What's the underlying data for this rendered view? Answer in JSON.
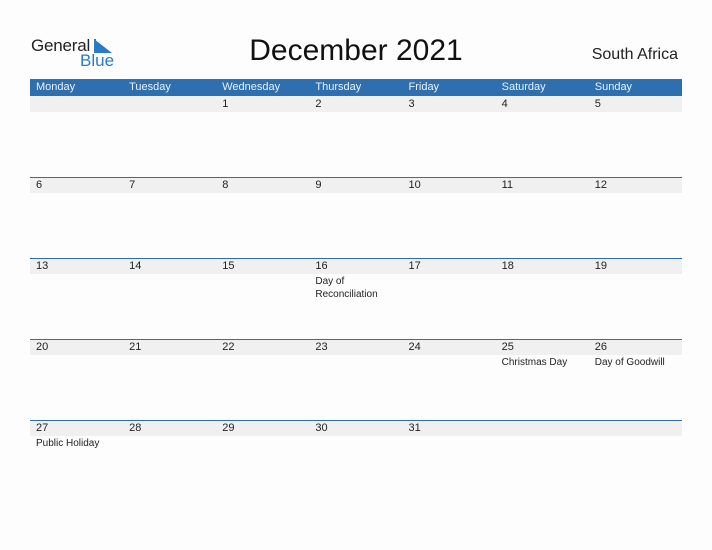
{
  "logo": {
    "line1": "General",
    "line2": "Blue"
  },
  "title": "December 2021",
  "country": "South Africa",
  "weekdays": [
    "Monday",
    "Tuesday",
    "Wednesday",
    "Thursday",
    "Friday",
    "Saturday",
    "Sunday"
  ],
  "weeks": [
    [
      {
        "d": ""
      },
      {
        "d": ""
      },
      {
        "d": "1"
      },
      {
        "d": "2"
      },
      {
        "d": "3"
      },
      {
        "d": "4"
      },
      {
        "d": "5"
      }
    ],
    [
      {
        "d": "6"
      },
      {
        "d": "7"
      },
      {
        "d": "8"
      },
      {
        "d": "9"
      },
      {
        "d": "10"
      },
      {
        "d": "11"
      },
      {
        "d": "12"
      }
    ],
    [
      {
        "d": "13"
      },
      {
        "d": "14"
      },
      {
        "d": "15"
      },
      {
        "d": "16",
        "h": "Day of Reconciliation"
      },
      {
        "d": "17"
      },
      {
        "d": "18"
      },
      {
        "d": "19"
      }
    ],
    [
      {
        "d": "20"
      },
      {
        "d": "21"
      },
      {
        "d": "22"
      },
      {
        "d": "23"
      },
      {
        "d": "24"
      },
      {
        "d": "25",
        "h": "Christmas Day"
      },
      {
        "d": "26",
        "h": "Day of Goodwill"
      }
    ],
    [
      {
        "d": "27",
        "h": "Public Holiday"
      },
      {
        "d": "28"
      },
      {
        "d": "29"
      },
      {
        "d": "30"
      },
      {
        "d": "31"
      },
      {
        "d": ""
      },
      {
        "d": ""
      }
    ]
  ],
  "colors": {
    "accent": "#2e6fb0",
    "logo_blue": "#2a7ac6",
    "row_strip": "#f0f0f0"
  }
}
